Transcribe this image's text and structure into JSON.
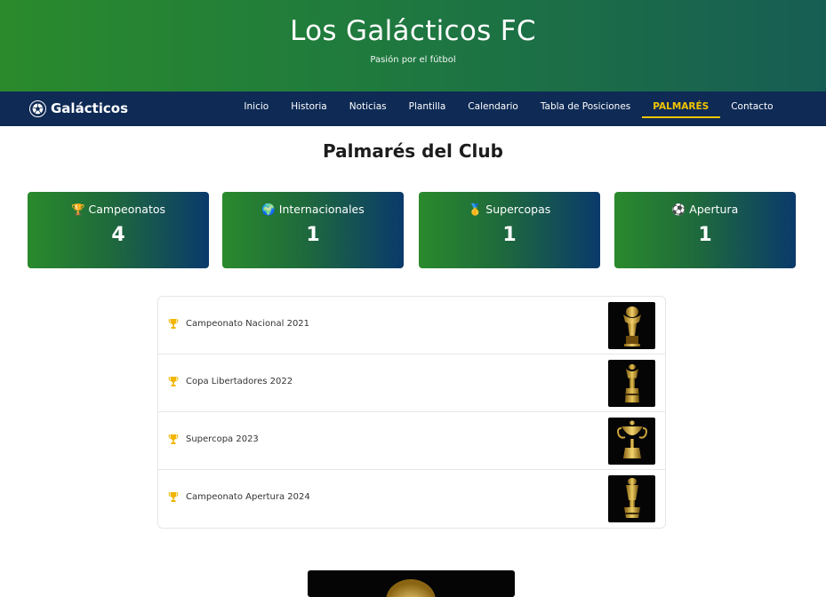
{
  "hero": {
    "title": "Los Galácticos FC",
    "subtitle": "Pasión por el fútbol"
  },
  "nav": {
    "brand": "Galácticos",
    "brand_icon": "soccer-ball-icon",
    "items": [
      {
        "label": "Inicio"
      },
      {
        "label": "Historia"
      },
      {
        "label": "Noticias"
      },
      {
        "label": "Plantilla"
      },
      {
        "label": "Calendario"
      },
      {
        "label": "Tabla de Posiciones"
      },
      {
        "label": "PALMARÉS",
        "active": true
      },
      {
        "label": "Contacto"
      }
    ]
  },
  "page": {
    "title": "Palmarés del Club"
  },
  "stats": [
    {
      "icon": "trophy-icon",
      "glyph": "🏆",
      "label": "Campeonatos",
      "value": "4"
    },
    {
      "icon": "globe-icon",
      "glyph": "🌍",
      "label": "Internacionales",
      "value": "1"
    },
    {
      "icon": "medal-icon",
      "glyph": "🥇",
      "label": "Supercopas",
      "value": "1"
    },
    {
      "icon": "soccer-ball-icon",
      "glyph": "⚽",
      "label": "Apertura",
      "value": "1"
    }
  ],
  "titles": [
    {
      "name": "Campeonato Nacional 2021"
    },
    {
      "name": "Copa Libertadores 2022"
    },
    {
      "name": "Supercopa 2023"
    },
    {
      "name": "Campeonato Apertura 2024"
    }
  ],
  "colors": {
    "accent": "#f2c500",
    "nav": "#0e2a55",
    "green": "#2a8a2c"
  }
}
